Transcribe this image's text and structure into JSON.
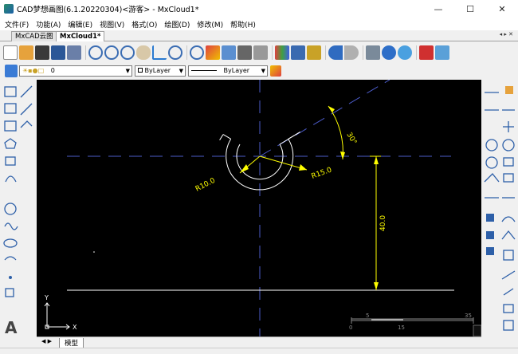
{
  "window": {
    "title": "CAD梦想画图(6.1.20220304)<游客> - MxCloud1*",
    "minimize": "—",
    "maximize": "☐",
    "close": "✕"
  },
  "menu": [
    "文件(F)",
    "功能(A)",
    "编辑(E)",
    "视图(V)",
    "格式(O)",
    "绘图(D)",
    "修改(M)",
    "帮助(H)"
  ],
  "tabs": {
    "items": [
      "MxCAD云图",
      "MxCloud1*"
    ],
    "active": 1,
    "nav": "◂ ▸ ✕"
  },
  "layer": {
    "value": "0"
  },
  "color_combo": {
    "value": "ByLayer"
  },
  "linetype_combo": {
    "value": "ByLayer"
  },
  "model_tab": "模型",
  "drawing": {
    "angle_label": "30°",
    "radius_small": "R10.0",
    "radius_large": "R15.0",
    "dim_vertical": "40.0",
    "scale_labels": [
      "0",
      "5",
      "15",
      "35"
    ],
    "ucs": {
      "x": "X",
      "y": "Y"
    }
  },
  "colors": {
    "canvas": "#000000",
    "entity": "#ffffff",
    "dimension": "#ffff00",
    "centerline": "#4b5bc8",
    "accent": "#1d5fa8"
  }
}
